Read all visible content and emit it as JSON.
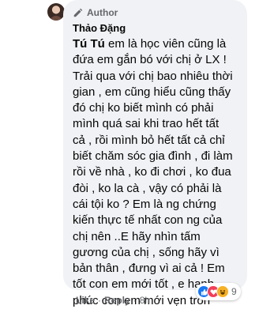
{
  "comment": {
    "author_badge": "Author",
    "name": "Thảo Đặng",
    "mention": "Tú Tú",
    "text": " em là học viên cũng là\nđứa em gắn bó với chị ở LX !\nTrải qua với chị bao nhiêu thời\ngian , em cũng hiểu cũng thấy\nđó chị ko biết mình có phải\nmình quá sai khi trao hết tất\ncả , rồi mình bỏ hết tất cả chỉ\nbiết chăm sóc gia đình , đi làm\nrồi về nhà , ko đi chơi , ko đua\nđòi , ko la cà , vậy có phải là\ncái tội ko ? Em là ng chứng\nkiến thực tế nhất con ng của\nchị nên ..E hãy nhìn tấm\ngương của chị , sống hãy vì\nbản thân , đưng vì ai cả ! Em\ntốt con em mới tốt , e hạnh\nphúc con em mới vẹn tròn"
  },
  "reactions": {
    "count": "9",
    "icons": [
      "like-icon",
      "love-icon",
      "haha-icon"
    ],
    "colors": {
      "like": "#1877f2",
      "love": "#f33e58",
      "haha": "#f7b125"
    }
  },
  "actions": {
    "like": "Like",
    "sep1": "·",
    "reply": "Reply",
    "sep2": "·",
    "time": "8h"
  }
}
